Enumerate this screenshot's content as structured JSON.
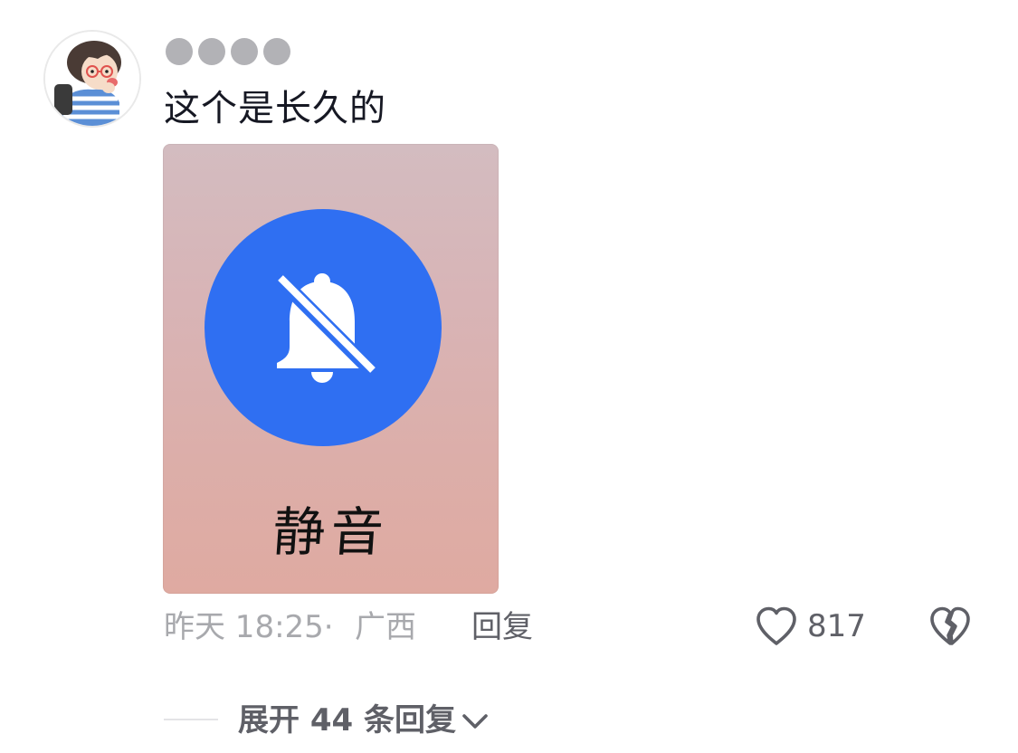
{
  "comment": {
    "username": "●●●●",
    "text": "这个是长久的",
    "image": {
      "caption": "静音",
      "icon": "bell-slash-icon",
      "circle_color": "#2f6ff2"
    },
    "time": "昨天 18:25·",
    "location": "广西",
    "reply_label": "回复",
    "like_count": "817",
    "expand_label": "展开 44 条回复"
  },
  "colors": {
    "primary_text": "#161823",
    "secondary_text": "#a8a9ad",
    "action_text": "#5f6067",
    "accent_blue": "#2f6ff2"
  }
}
